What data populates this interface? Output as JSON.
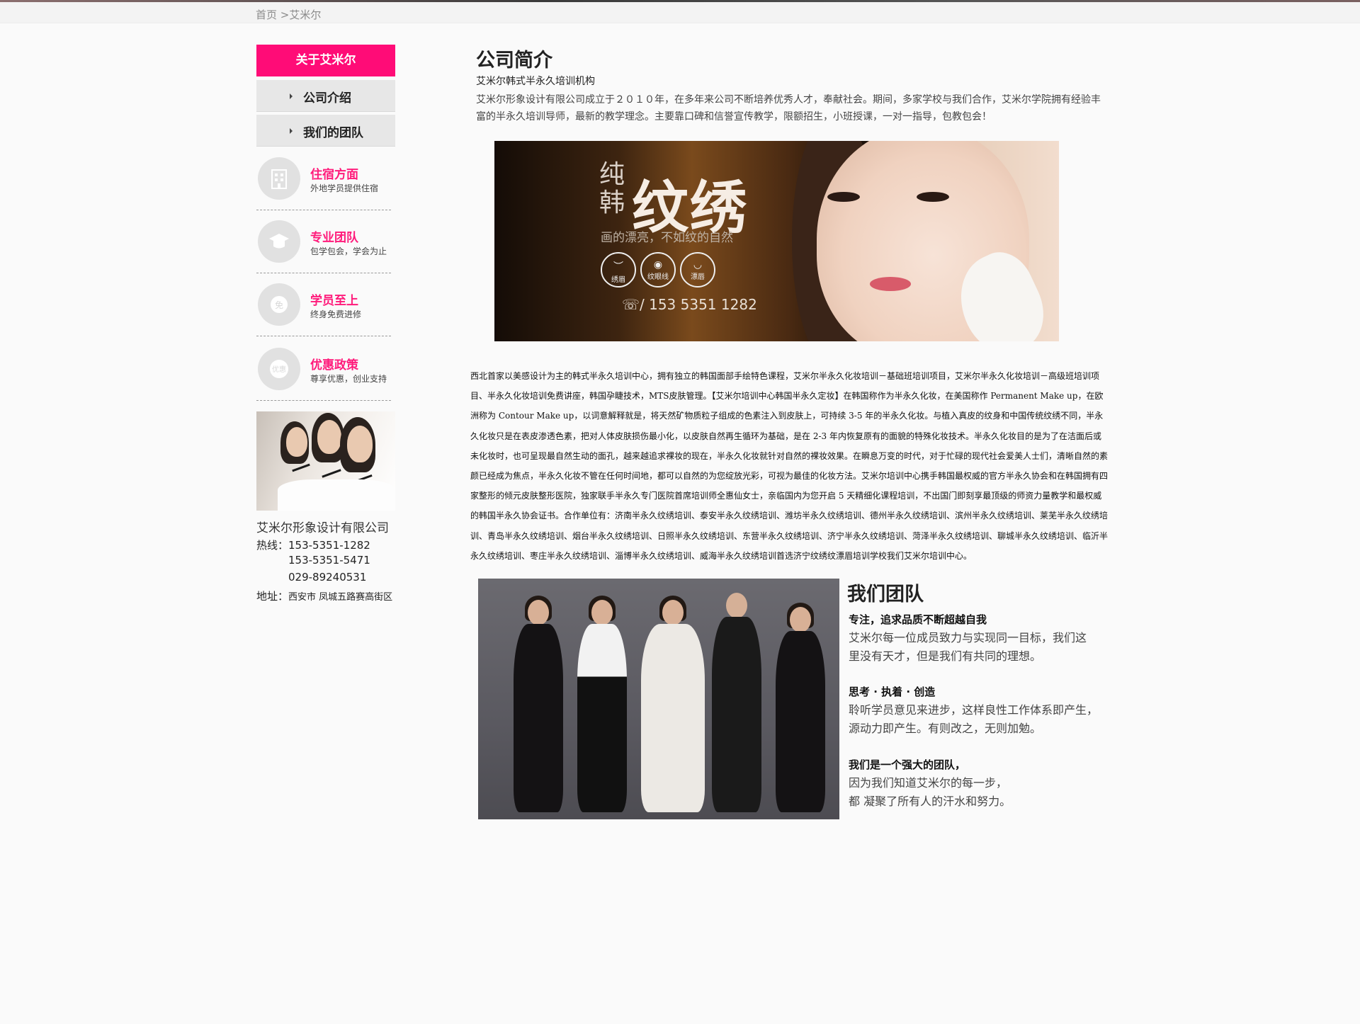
{
  "breadcrumb": {
    "home": "首页",
    "sep": " >",
    "current": "艾米尔"
  },
  "sidebar": {
    "header": "关于艾米尔",
    "nav": [
      {
        "label": "公司介绍"
      },
      {
        "label": "我们的团队"
      }
    ],
    "features": [
      {
        "title": "住宿方面",
        "sub": "外地学员提供住宿",
        "icon": "building-icon"
      },
      {
        "title": "专业团队",
        "sub": "包学包会，学会为止",
        "icon": "graduation-cap-icon"
      },
      {
        "title": "学员至上",
        "sub": "终身免费进修",
        "icon": "free-badge-icon",
        "icon_text": "免"
      },
      {
        "title": "优惠政策",
        "sub": "尊享优惠，创业支持",
        "icon": "discount-badge-icon",
        "icon_text": "优惠"
      }
    ],
    "company": "艾米尔形象设计有限公司",
    "hotline_label": "热线：",
    "phones": [
      "153-5351-1282",
      "153-5351-5471",
      "029-89240531"
    ],
    "address_label": "地址：",
    "address": "西安市 凤城五路赛高街区"
  },
  "main": {
    "title": "公司简介",
    "subtitle": "艾米尔韩式半永久培训机构",
    "intro": "艾米尔形象设计有限公司成立于２０１０年，在多年来公司不断培养优秀人才，奉献社会。期间，多家学校与我们合作，艾米尔学院拥有经验丰富的半永久培训导师，最新的教学理念。主要靠口碑和信誉宣传教学，限额招生，小班授课，一对一指导，包教包会！",
    "banner": {
      "small": "纯韩",
      "big": "纹绣",
      "tagline": "画的漂亮，不如纹的自然",
      "icons": [
        {
          "label": "绣眉",
          "sym": "︶"
        },
        {
          "label": "纹眼线",
          "sym": "◉"
        },
        {
          "label": "漂唇",
          "sym": "◡"
        }
      ],
      "phone": "☏/ 153 5351 1282"
    },
    "body": "西北首家以美感设计为主的韩式半永久培训中心，拥有独立的韩国面部手绘特色课程，艾米尔半永久化妆培训－基础班培训项目，艾米尔半永久化妆培训－高级班培训项目、半永久化妆培训免费讲座，韩国孕睫技术，MTS皮肤管理。【艾米尔培训中心韩国半永久定妆】在韩国称作为半永久化妆，在美国称作 Permanent Make up，在欧洲称为 Contour Make up，以词意解释就是，将天然矿物质粒子组成的色素注入到皮肤上，可持续 3-5 年的半永久化妆。与植入真皮的纹身和中国传统纹绣不同，半永久化妆只是在表皮渗透色素，把对人体皮肤损伤最小化，以皮肤自然再生循环为基础，是在 2-3 年内恢复原有的面貌的特殊化妆技术。半永久化妆目的是为了在洁面后或未化妆时，也可呈现最自然生动的面孔，越来越追求裸妆的现在，半永久化妆就针对自然的裸妆效果。在瞬息万变的时代，对于忙碌的现代社会爱美人士们，清晰自然的素颜已经成为焦点，半永久化妆不管在任何时间地，都可以自然的为您绽放光彩，可视为最佳的化妆方法。艾米尔培训中心携手韩国最权威的官方半永久协会和在韩国拥有四家整形的倾元皮肤整形医院，独家联手半永久专门医院首席培训师全惠仙女士，亲临国内为您开启 5 天精细化课程培训，不出国门即刻享最顶级的师资力量教学和最权威的韩国半永久协会证书。合作单位有：济南半永久纹绣培训、泰安半永久纹绣培训、潍坊半永久纹绣培训、德州半永久纹绣培训、滨州半永久纹绣培训、莱芜半永久纹绣培训、青岛半永久纹绣培训、烟台半永久纹绣培训、日照半永久纹绣培训、东营半永久纹绣培训、济宁半永久纹绣培训、菏泽半永久纹绣培训、聊城半永久纹绣培训、临沂半永久纹绣培训、枣庄半永久纹绣培训、淄博半永久纹绣培训、威海半永久纹绣培训首选济宁纹绣纹漂眉培训学校我们艾米尔培训中心。",
    "team": {
      "title": "我们团队",
      "paragraphs": [
        {
          "head": "专注，追求品质不断超越自我",
          "line1": "艾米尔每一位成员致力与实现同一目标，我们这",
          "line2": "里没有天才，但是我们有共同的理想。"
        },
        {
          "head": "思考 · 执着 · 创造",
          "line1": "聆听学员意见来进步，这样良性工作体系即产生，",
          "line2": "源动力即产生。有则改之，无则加勉。"
        },
        {
          "head": "我们是一个强大的团队，",
          "line1": "因为我们知道艾米尔的每一步，",
          "line2": "都 凝聚了所有人的汗水和努力。"
        }
      ]
    }
  },
  "colors": {
    "accent": "#ff0c77",
    "feature_title": "#ff1b7b"
  }
}
